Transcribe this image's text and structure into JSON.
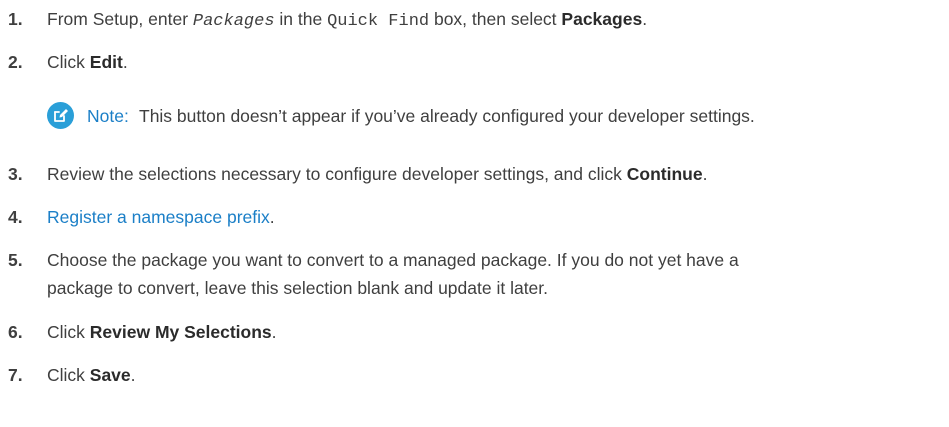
{
  "steps": [
    {
      "num": "1.",
      "pre": "From Setup, enter ",
      "code_italic": "Packages",
      "mid": " in the ",
      "code": "Quick Find",
      "post": " box, then select ",
      "bold": "Packages",
      "end": "."
    },
    {
      "num": "2.",
      "pre": "Click ",
      "bold": "Edit",
      "end": "."
    },
    {
      "num": "3.",
      "pre": "Review the selections necessary to configure developer settings, and click ",
      "bold": "Continue",
      "end": "."
    },
    {
      "num": "4.",
      "link": "Register a namespace prefix",
      "end": "."
    },
    {
      "num": "5.",
      "line1": "Choose the package you want to convert to a managed package. If you do not yet have a",
      "line2": "package to convert, leave this selection blank and update it later."
    },
    {
      "num": "6.",
      "pre": "Click ",
      "bold": "Review My Selections",
      "end": "."
    },
    {
      "num": "7.",
      "pre": "Click ",
      "bold": "Save",
      "end": "."
    }
  ],
  "note": {
    "icon": "edit-icon",
    "label": "Note:",
    "text": "This button doesn’t appear if you’ve already configured your developer settings."
  },
  "colors": {
    "link": "#1b7fc7",
    "note_icon": "#2a9fd8",
    "text": "#3f3f3f"
  }
}
